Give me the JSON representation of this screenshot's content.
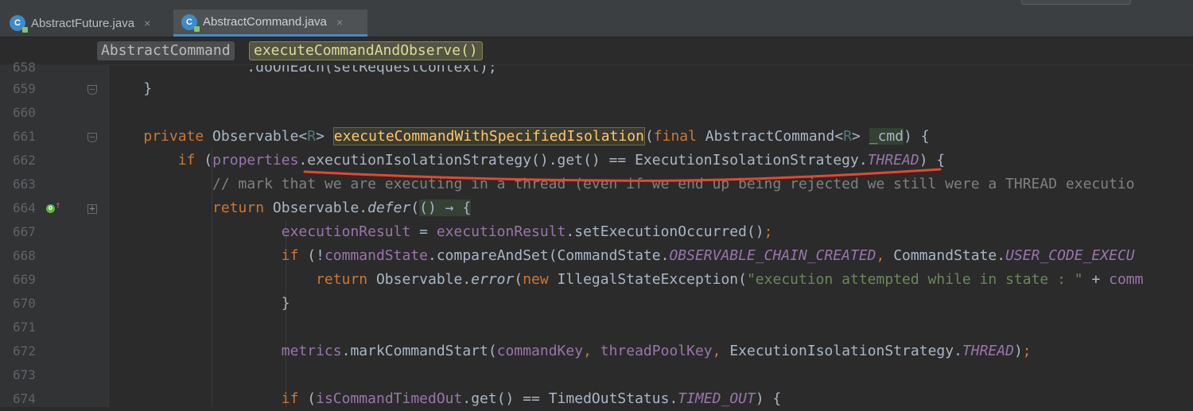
{
  "tabs": [
    {
      "label": "AbstractFuture.java",
      "icon": "class-file-icon",
      "close": "×",
      "active": false
    },
    {
      "label": "AbstractCommand.java",
      "icon": "class-file-icon",
      "close": "×",
      "active": true
    }
  ],
  "breadcrumbs": [
    "AbstractCommand",
    "executeCommandAndObserve()"
  ],
  "lines": [
    {
      "num": "658",
      "text": "                .doOnEach(setRequestContext);"
    },
    {
      "num": "659",
      "text": "    }"
    },
    {
      "num": "660",
      "text": ""
    },
    {
      "num": "661",
      "text": "    private Observable<R> executeCommandWithSpecifiedIsolation(final AbstractCommand<R> _cmd) {"
    },
    {
      "num": "662",
      "text": "        if (properties.executionIsolationStrategy().get() == ExecutionIsolationStrategy.THREAD) {"
    },
    {
      "num": "663",
      "text": "            // mark that we are executing in a thread (even if we end up being rejected we still were a THREAD executio"
    },
    {
      "num": "664",
      "text": "            return Observable.defer(() → {"
    },
    {
      "num": "667",
      "text": "                    executionResult = executionResult.setExecutionOccurred();"
    },
    {
      "num": "668",
      "text": "                    if (!commandState.compareAndSet(CommandState.OBSERVABLE_CHAIN_CREATED, CommandState.USER_CODE_EXECU"
    },
    {
      "num": "669",
      "text": "                        return Observable.error(new IllegalStateException(\"execution attempted while in state : \" + comm"
    },
    {
      "num": "670",
      "text": "                    }"
    },
    {
      "num": "671",
      "text": ""
    },
    {
      "num": "672",
      "text": "                    metrics.markCommandStart(commandKey, threadPoolKey, ExecutionIsolationStrategy.THREAD);"
    },
    {
      "num": "673",
      "text": ""
    },
    {
      "num": "674",
      "text": "                    if (isCommandTimedOut.get() == TimedOutStatus.TIMED_OUT) {"
    }
  ],
  "colors": {
    "background": "#2b2b2b",
    "keyword": "#cc7832",
    "field": "#9876aa",
    "method_highlight": "#ffc66d",
    "comment": "#808080",
    "string": "#6a8759",
    "annotation_underline": "#e8462e"
  }
}
